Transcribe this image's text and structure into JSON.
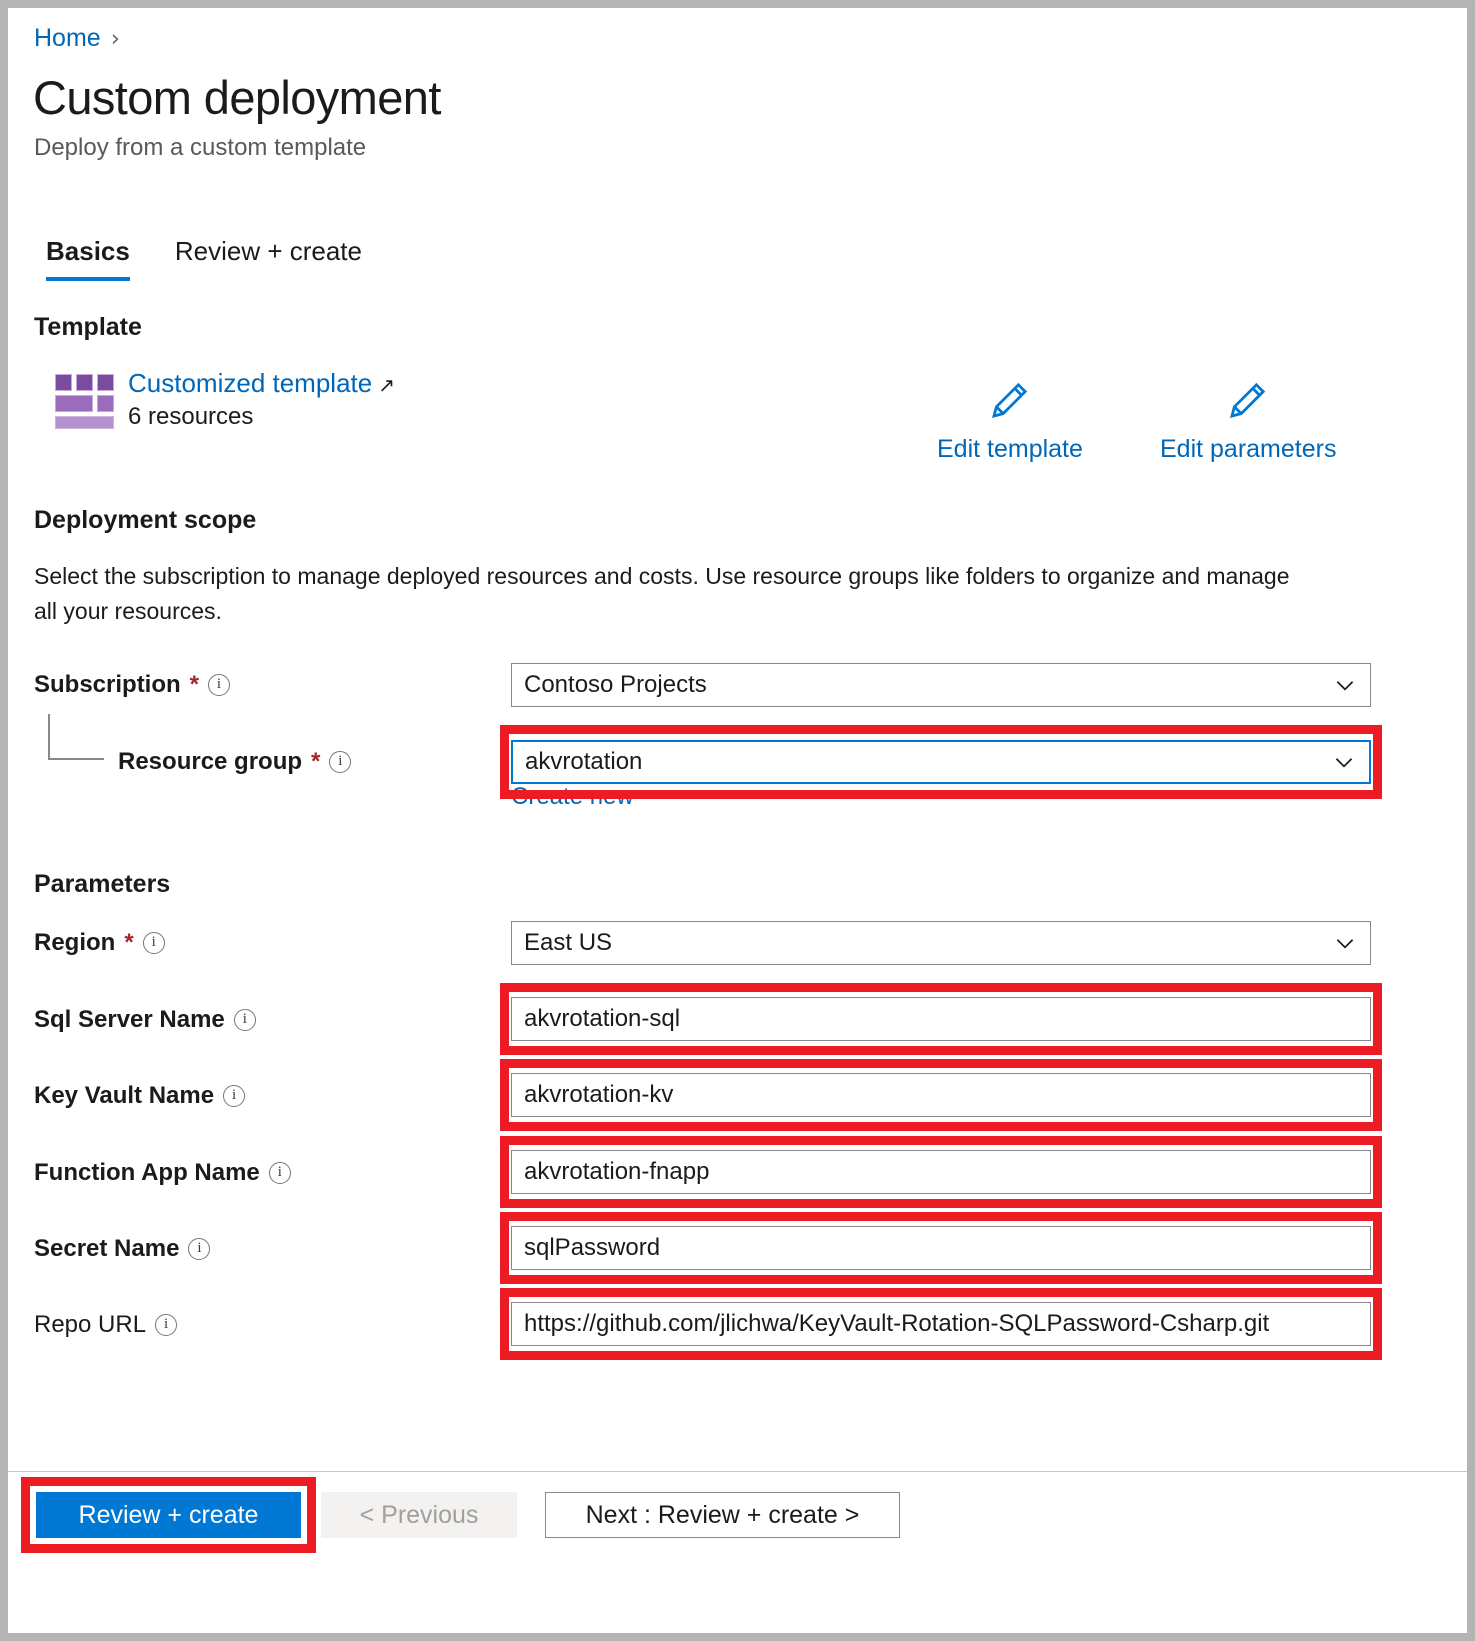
{
  "breadcrumb": {
    "home": "Home",
    "separator": "›"
  },
  "header": {
    "title": "Custom deployment",
    "subtitle": "Deploy from a custom template"
  },
  "tabs": [
    {
      "label": "Basics",
      "active": true
    },
    {
      "label": "Review + create",
      "active": false
    }
  ],
  "template": {
    "heading": "Template",
    "link_label": "Customized template",
    "external_glyph": "↗",
    "resources_count": "6 resources",
    "edit_template_label": "Edit template",
    "edit_parameters_label": "Edit parameters"
  },
  "deployment_scope": {
    "heading": "Deployment scope",
    "description": "Select the subscription to manage deployed resources and costs. Use resource groups like folders to organize and manage all your resources.",
    "subscription": {
      "label": "Subscription",
      "required_marker": "*",
      "value": "Contoso Projects"
    },
    "resource_group": {
      "label": "Resource group",
      "required_marker": "*",
      "value": "akvrotation",
      "create_new_label": "Create new"
    }
  },
  "parameters": {
    "heading": "Parameters",
    "fields": [
      {
        "label": "Region",
        "required_marker": "*",
        "value": "East US",
        "type": "dropdown",
        "highlighted": false
      },
      {
        "label": "Sql Server Name",
        "required_marker": "",
        "value": "akvrotation-sql",
        "type": "text",
        "highlighted": true
      },
      {
        "label": "Key Vault Name",
        "required_marker": "",
        "value": "akvrotation-kv",
        "type": "text",
        "highlighted": true
      },
      {
        "label": "Function App Name",
        "required_marker": "",
        "value": "akvrotation-fnapp",
        "type": "text",
        "highlighted": true
      },
      {
        "label": "Secret Name",
        "required_marker": "",
        "value": "sqlPassword",
        "type": "text",
        "highlighted": true
      },
      {
        "label": "Repo URL",
        "required_marker": "",
        "value": "https://github.com/jlichwa/KeyVault-Rotation-SQLPassword-Csharp.git",
        "type": "text",
        "highlighted": true
      }
    ]
  },
  "footer": {
    "review_create_label": "Review + create",
    "previous_label": "< Previous",
    "next_label": "Next : Review + create >"
  },
  "colors": {
    "accent_blue": "#0078d4",
    "link_blue": "#0067b8",
    "annotation_red": "#ed1c24",
    "required_red": "#a4262c",
    "template_purple": "#7a4c9e",
    "page_border_gray": "#b4b4b4"
  }
}
